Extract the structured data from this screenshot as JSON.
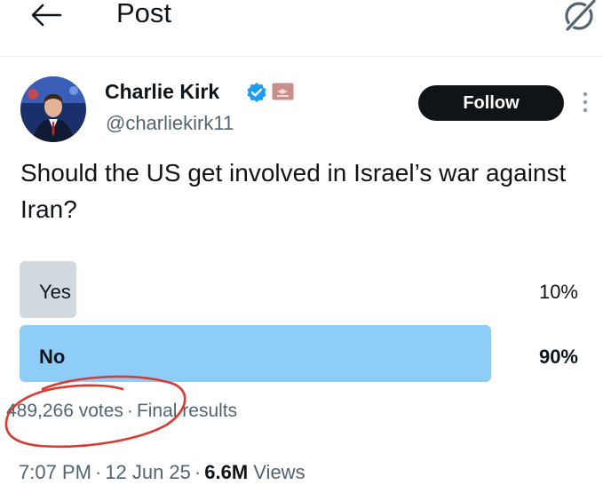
{
  "header": {
    "title": "Post",
    "back_icon": "arrow-left-icon",
    "right_icon": "grok-icon"
  },
  "author": {
    "name": "Charlie Kirk",
    "handle": "@charliekirk11",
    "verified_icon": "verified-badge-icon",
    "affiliate_icon": "affiliate-badge-icon",
    "follow_label": "Follow",
    "more_icon": "more-vertical-icon"
  },
  "post": {
    "text": "Should the US get involved in Israel’s war against Iran?"
  },
  "poll": {
    "options": [
      {
        "label": "Yes",
        "percent_label": "10%",
        "percent": 10
      },
      {
        "label": "No",
        "percent_label": "90%",
        "percent": 90
      }
    ],
    "votes": "489,266 votes",
    "separator": "·",
    "status": "Final results"
  },
  "meta": {
    "time": "7:07 PM",
    "date": "12 Jun 25",
    "separator": "·",
    "views_count": "6.6M",
    "views_label": "Views"
  },
  "colors": {
    "text_primary": "#0f1419",
    "text_secondary": "#536471",
    "poll_winner": "#8ecdf8",
    "poll_other": "#cfd9de",
    "verified": "#1d9bf0",
    "annotation": "#d93a32"
  }
}
